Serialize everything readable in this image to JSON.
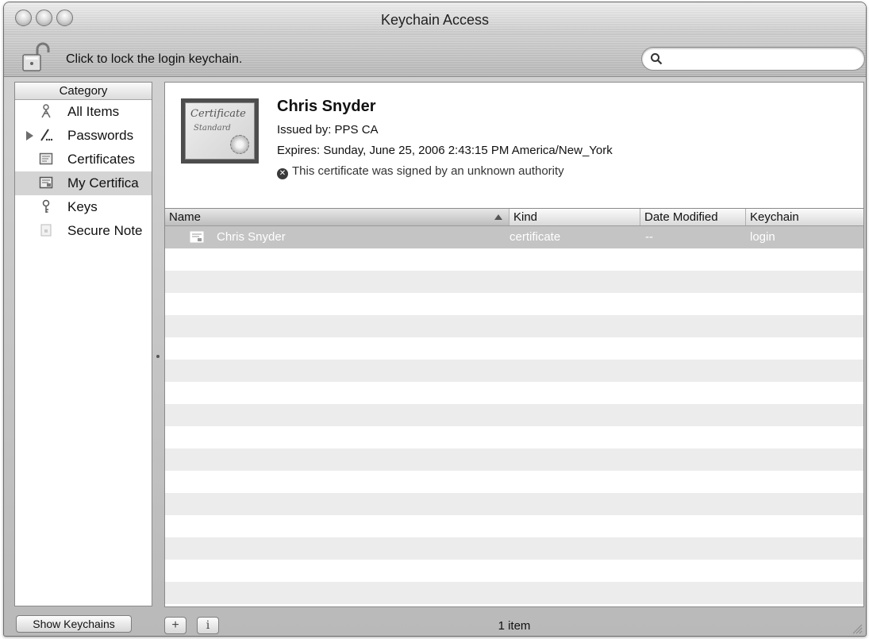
{
  "window": {
    "title": "Keychain Access"
  },
  "toolbar": {
    "lock_label": "Click to lock the login keychain.",
    "search_value": "",
    "search_placeholder": ""
  },
  "sidebar": {
    "header": "Category",
    "items": [
      {
        "label": "All Items",
        "icon": "all-items-icon"
      },
      {
        "label": "Passwords",
        "icon": "passwords-icon"
      },
      {
        "label": "Certificates",
        "icon": "certificates-icon"
      },
      {
        "label": "My Certifica",
        "icon": "my-certificates-icon"
      },
      {
        "label": "Keys",
        "icon": "keys-icon"
      },
      {
        "label": "Secure Note",
        "icon": "secure-notes-icon"
      }
    ]
  },
  "detail": {
    "cert_thumb_title": "Certificate",
    "cert_thumb_subtitle": "Standard",
    "name": "Chris Snyder",
    "issuer": "Issued by: PPS CA",
    "expires": "Expires: Sunday, June 25, 2006 2:43:15 PM America/New_York",
    "warning": "This certificate was signed by an unknown authority"
  },
  "table": {
    "columns": {
      "name": "Name",
      "kind": "Kind",
      "date": "Date Modified",
      "keychain": "Keychain"
    },
    "rows": [
      {
        "name": "Chris Snyder",
        "kind": "certificate",
        "date": "--",
        "keychain": "login"
      }
    ]
  },
  "bottombar": {
    "show_keychains": "Show Keychains",
    "add": "+",
    "info": "i",
    "item_count": "1 item"
  },
  "colors": {
    "selection": "#c4c4c4",
    "alt_row": "#ececec"
  }
}
